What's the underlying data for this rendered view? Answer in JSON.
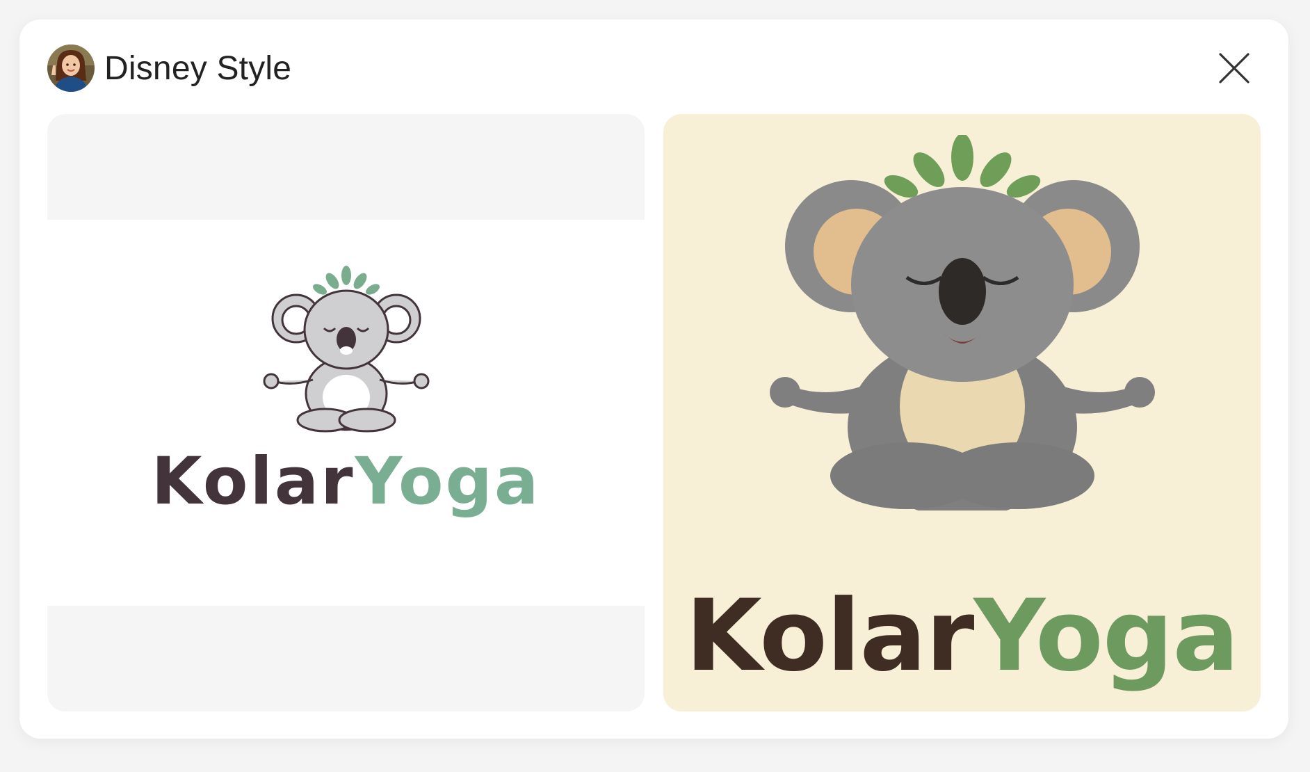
{
  "dialog": {
    "title": "Disney Style",
    "avatar_icon": "avatar-icon",
    "close_icon": "close-icon"
  },
  "original": {
    "wordmark_part1": "Kolar",
    "wordmark_part2": "Yoga",
    "colors": {
      "dark": "#43333a",
      "green": "#7aae92"
    }
  },
  "styled": {
    "wordmark_part1": "Kolar",
    "wordmark_part2": "Yoga",
    "colors": {
      "background": "#f8efd7",
      "dark": "#3f2c22",
      "green": "#6d9a5e"
    }
  }
}
